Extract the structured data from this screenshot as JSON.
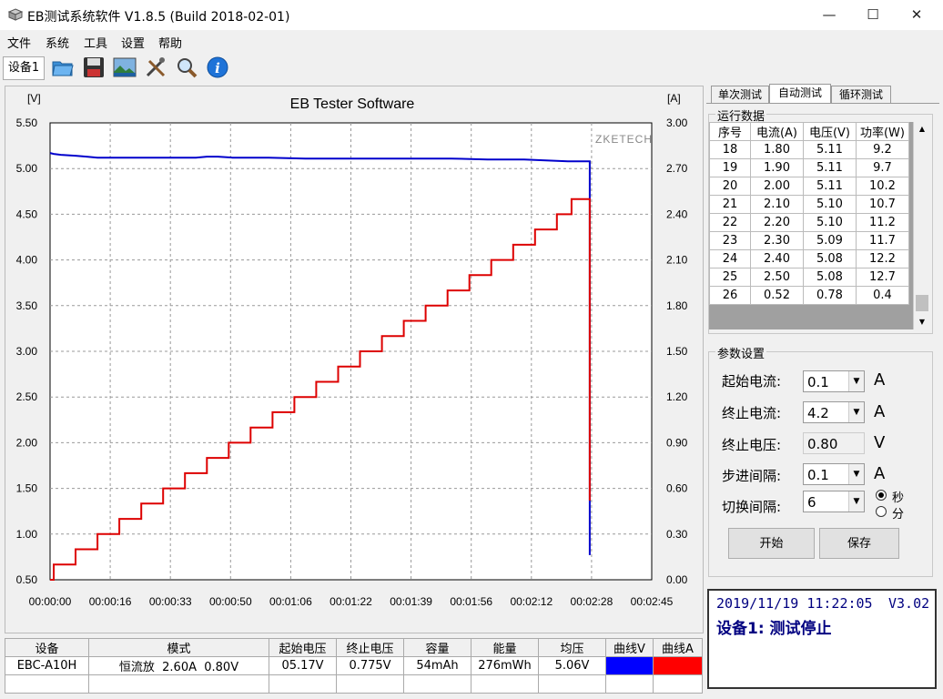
{
  "window": {
    "title": "EB测试系统软件 V1.8.5 (Build 2018-02-01)",
    "minimize": "—",
    "maximize": "☐",
    "close": "✕"
  },
  "menu": [
    "文件",
    "系统",
    "工具",
    "设置",
    "帮助"
  ],
  "toolbar": {
    "device_tab": "设备1",
    "icons": [
      "open-folder-icon",
      "save-disk-icon",
      "landscape-image-icon",
      "tools-icon",
      "magnifier-icon",
      "info-icon"
    ]
  },
  "chart_data": {
    "type": "line",
    "title": "EB Tester Software",
    "watermark": "ZKETECH",
    "left_unit": "[V]",
    "right_unit": "[A]",
    "y_left": {
      "min": 0.5,
      "max": 5.5,
      "ticks": [
        "0.50",
        "1.00",
        "1.50",
        "2.00",
        "2.50",
        "3.00",
        "3.50",
        "4.00",
        "4.50",
        "5.00",
        "5.50"
      ]
    },
    "y_right": {
      "min": 0,
      "max": 3,
      "ticks": [
        "0.00",
        "0.30",
        "0.60",
        "0.90",
        "1.20",
        "1.50",
        "1.80",
        "2.10",
        "2.40",
        "2.70",
        "3.00"
      ]
    },
    "x_ticks": [
      "00:00:00",
      "00:00:16",
      "00:00:33",
      "00:00:50",
      "00:01:06",
      "00:01:22",
      "00:01:39",
      "00:01:56",
      "00:02:12",
      "00:02:28",
      "00:02:45"
    ],
    "x_range_s": [
      0,
      165
    ],
    "grid": true,
    "series": [
      {
        "axis": "left",
        "color": "#0000cc",
        "points": [
          [
            0,
            5.17
          ],
          [
            1,
            5.16
          ],
          [
            3,
            5.15
          ],
          [
            7,
            5.14
          ],
          [
            10,
            5.13
          ],
          [
            13,
            5.12
          ],
          [
            20,
            5.12
          ],
          [
            30,
            5.12
          ],
          [
            40,
            5.12
          ],
          [
            43,
            5.13
          ],
          [
            46,
            5.13
          ],
          [
            50,
            5.12
          ],
          [
            60,
            5.12
          ],
          [
            70,
            5.11
          ],
          [
            80,
            5.11
          ],
          [
            90,
            5.11
          ],
          [
            100,
            5.11
          ],
          [
            110,
            5.11
          ],
          [
            120,
            5.1
          ],
          [
            130,
            5.1
          ],
          [
            136,
            5.09
          ],
          [
            142,
            5.08
          ],
          [
            145,
            5.08
          ],
          [
            148,
            5.08
          ],
          [
            148,
            0.77
          ]
        ]
      },
      {
        "axis": "right",
        "color": "#dd0000",
        "steps": [
          [
            0,
            0.0
          ],
          [
            1,
            0.1
          ],
          [
            7,
            0.2
          ],
          [
            13,
            0.3
          ],
          [
            19,
            0.4
          ],
          [
            25,
            0.5
          ],
          [
            31,
            0.6
          ],
          [
            37,
            0.7
          ],
          [
            43,
            0.8
          ],
          [
            49,
            0.9
          ],
          [
            55,
            1.0
          ],
          [
            61,
            1.1
          ],
          [
            67,
            1.2
          ],
          [
            73,
            1.3
          ],
          [
            79,
            1.4
          ],
          [
            85,
            1.5
          ],
          [
            91,
            1.6
          ],
          [
            97,
            1.7
          ],
          [
            103,
            1.8
          ],
          [
            109,
            1.9
          ],
          [
            115,
            2.0
          ],
          [
            121,
            2.1
          ],
          [
            127,
            2.2
          ],
          [
            133,
            2.3
          ],
          [
            139,
            2.4
          ],
          [
            143,
            2.5
          ],
          [
            148,
            0.52
          ]
        ]
      }
    ]
  },
  "right": {
    "tabs": [
      "单次测试",
      "自动测试",
      "循环测试"
    ],
    "run_data": {
      "title": "运行数据",
      "headers": [
        "序号",
        "电流(A)",
        "电压(V)",
        "功率(W)"
      ],
      "rows": [
        [
          "18",
          "1.80",
          "5.11",
          "9.2"
        ],
        [
          "19",
          "1.90",
          "5.11",
          "9.7"
        ],
        [
          "20",
          "2.00",
          "5.11",
          "10.2"
        ],
        [
          "21",
          "2.10",
          "5.10",
          "10.7"
        ],
        [
          "22",
          "2.20",
          "5.10",
          "11.2"
        ],
        [
          "23",
          "2.30",
          "5.09",
          "11.7"
        ],
        [
          "24",
          "2.40",
          "5.08",
          "12.2"
        ],
        [
          "25",
          "2.50",
          "5.08",
          "12.7"
        ],
        [
          "26",
          "0.52",
          "0.78",
          "0.4"
        ]
      ]
    },
    "params": {
      "title": "参数设置",
      "start_current_label": "起始电流:",
      "start_current_value": "0.1",
      "start_current_unit": "A",
      "end_current_label": "终止电流:",
      "end_current_value": "4.2",
      "end_current_unit": "A",
      "end_voltage_label": "终止电压:",
      "end_voltage_value": "0.80",
      "end_voltage_unit": "V",
      "step_label": "步进间隔:",
      "step_value": "0.1",
      "step_unit": "A",
      "switch_label": "切换间隔:",
      "switch_value": "6",
      "radio_sec": "秒",
      "radio_min": "分",
      "start_button": "开始",
      "save_button": "保存"
    },
    "status": {
      "datetime": "2019/11/19 11:22:05",
      "version": "V3.02",
      "message": "设备1: 测试停止"
    }
  },
  "bottom": {
    "headers": [
      "设备",
      "模式",
      "起始电压",
      "终止电压",
      "容量",
      "能量",
      "均压",
      "曲线V",
      "曲线A"
    ],
    "row": [
      "EBC-A10H",
      "恒流放  2.60A  0.80V",
      "05.17V",
      "0.775V",
      "54mAh",
      "276mWh",
      "5.06V",
      "",
      ""
    ],
    "curve_v_color": "#0000ff",
    "curve_a_color": "#ff0000"
  }
}
